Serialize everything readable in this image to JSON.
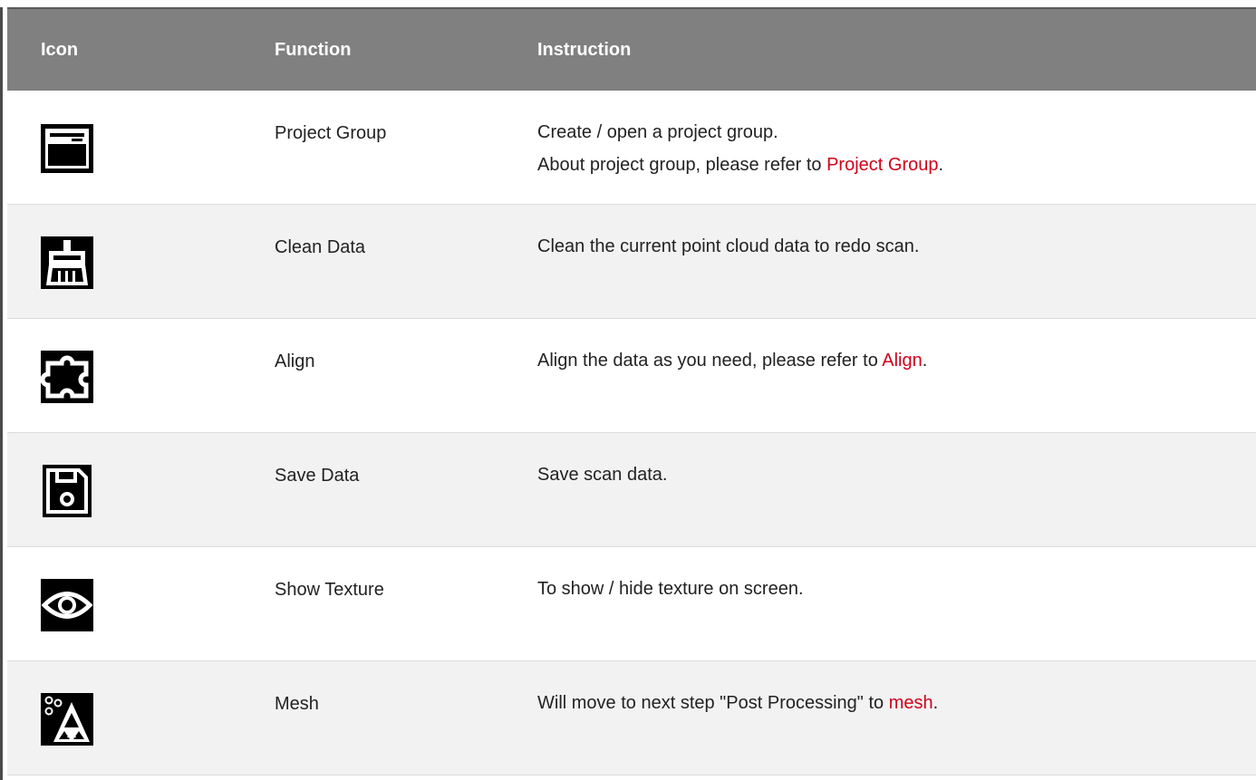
{
  "header": {
    "col_icon": "Icon",
    "col_function": "Function",
    "col_instruction": "Instruction"
  },
  "rows": [
    {
      "icon": "window-icon",
      "function": "Project Group",
      "instruction_lines": [
        {
          "text": "Create / open a project group.",
          "link": "",
          "after": ""
        },
        {
          "text": "About project group, please refer to ",
          "link": "Project Group",
          "after": "."
        }
      ]
    },
    {
      "icon": "broom-icon",
      "function": "Clean Data",
      "instruction_lines": [
        {
          "text": "Clean the current point cloud data to redo scan.",
          "link": "",
          "after": ""
        }
      ]
    },
    {
      "icon": "puzzle-icon",
      "function": "Align",
      "instruction_lines": [
        {
          "text": "Align the data as you need, please refer to ",
          "link": "Align",
          "after": "."
        }
      ]
    },
    {
      "icon": "floppy-icon",
      "function": "Save Data",
      "instruction_lines": [
        {
          "text": "Save scan data.",
          "link": "",
          "after": ""
        }
      ]
    },
    {
      "icon": "eye-icon",
      "function": "Show Texture",
      "instruction_lines": [
        {
          "text": "To show / hide texture on screen.",
          "link": "",
          "after": ""
        }
      ]
    },
    {
      "icon": "mesh-icon",
      "function": "Mesh",
      "instruction_lines": [
        {
          "text": "Will move to next step \"Post Processing\" to ",
          "link": "mesh",
          "after": "."
        }
      ]
    }
  ],
  "colors": {
    "header_bg": "#808080",
    "link": "#d0021b",
    "row_alt": "#f2f2f2"
  }
}
